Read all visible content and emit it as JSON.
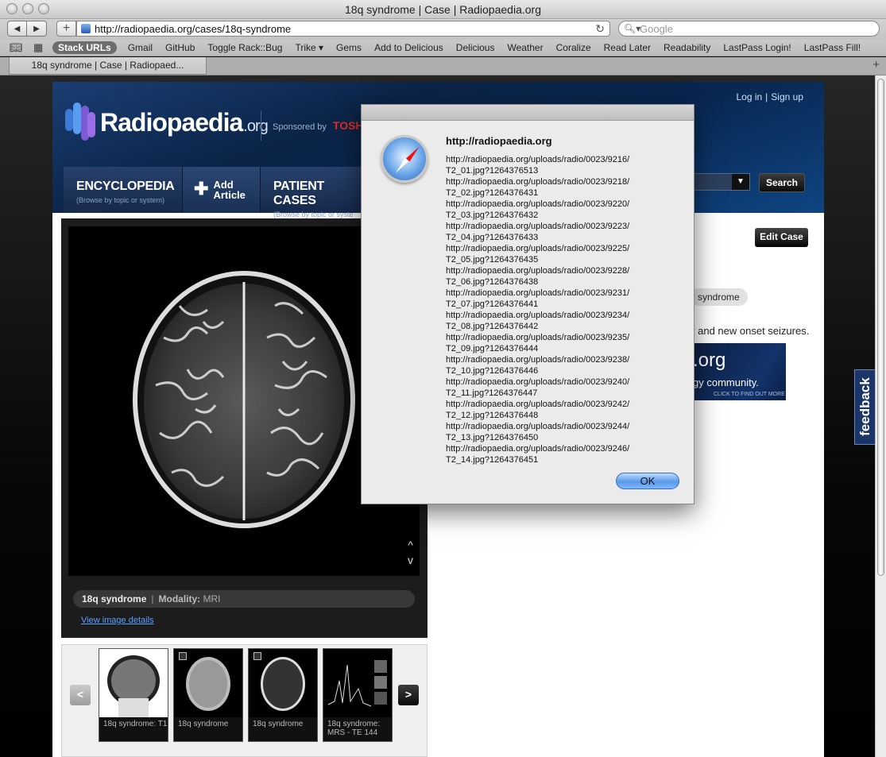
{
  "window": {
    "title": "18q syndrome | Case | Radiopaedia.org"
  },
  "toolbar": {
    "url": "http://radiopaedia.org/cases/18q-syndrome",
    "search_placeholder": "Google"
  },
  "bookmarks": [
    "Stack URLs",
    "Gmail",
    "GitHub",
    "Toggle Rack::Bug",
    "Trike ▾",
    "Gems",
    "Add to Delicious",
    "Delicious",
    "Weather",
    "Coralize",
    "Read Later",
    "Readability",
    "LastPass Login!",
    "LastPass Fill!"
  ],
  "tab": {
    "label": "18q syndrome | Case | Radiopaed..."
  },
  "site": {
    "logo_word": "Radiopaedia",
    "logo_tld": ".org",
    "sponsored_by": "Sponsored by",
    "sponsor_logo": "TOSH",
    "login": "Log in",
    "signup": "Sign up",
    "nav": {
      "encyclopedia": "ENCYCLOPEDIA",
      "encyclopedia_sub": "(Browse by topic or system)",
      "add_article_1": "Add",
      "add_article_2": "Article",
      "patient_cases": "PATIENT CASES",
      "patient_cases_sub": "(Browse by topic or syste"
    },
    "search_button": "Search",
    "edit_case": "Edit Case",
    "tag": "syndrome",
    "snippet": "y and new onset seizures.",
    "banner_1": ".org",
    "banner_2": "gy community.",
    "banner_3": "CLICK TO FIND OUT MORE",
    "feedback": "feedback"
  },
  "viewer": {
    "caption": "18q syndrome",
    "modality_label": "Modality:",
    "modality": "MRI",
    "view_details": "View image details",
    "scroll_up": "^",
    "scroll_down": "v",
    "prev": "<",
    "next": ">",
    "thumbnails": [
      {
        "label": "18q syndrome: T1"
      },
      {
        "label": "18q syndrome"
      },
      {
        "label": "18q syndrome"
      },
      {
        "label": "18q syndrome: MRS - TE 144"
      }
    ]
  },
  "dialog": {
    "title": "http://radiopaedia.org",
    "lines": [
      "http://radiopaedia.org/uploads/radio/0023/9216/",
      "T2_01.jpg?1264376513",
      "http://radiopaedia.org/uploads/radio/0023/9218/",
      "T2_02.jpg?1264376431",
      "http://radiopaedia.org/uploads/radio/0023/9220/",
      "T2_03.jpg?1264376432",
      "http://radiopaedia.org/uploads/radio/0023/9223/",
      "T2_04.jpg?1264376433",
      "http://radiopaedia.org/uploads/radio/0023/9225/",
      "T2_05.jpg?1264376435",
      "http://radiopaedia.org/uploads/radio/0023/9228/",
      "T2_06.jpg?1264376438",
      "http://radiopaedia.org/uploads/radio/0023/9231/",
      "T2_07.jpg?1264376441",
      "http://radiopaedia.org/uploads/radio/0023/9234/",
      "T2_08.jpg?1264376442",
      "http://radiopaedia.org/uploads/radio/0023/9235/",
      "T2_09.jpg?1264376444",
      "http://radiopaedia.org/uploads/radio/0023/9238/",
      "T2_10.jpg?1264376446",
      "http://radiopaedia.org/uploads/radio/0023/9240/",
      "T2_11.jpg?1264376447",
      "http://radiopaedia.org/uploads/radio/0023/9242/",
      "T2_12.jpg?1264376448",
      "http://radiopaedia.org/uploads/radio/0023/9244/",
      "T2_13.jpg?1264376450",
      "http://radiopaedia.org/uploads/radio/0023/9246/",
      "T2_14.jpg?1264376451"
    ],
    "ok": "OK"
  },
  "colors": {
    "site_header": "#0b2447",
    "ok_button": "#5b9ae8",
    "feedback_tab": "#1b3568"
  }
}
